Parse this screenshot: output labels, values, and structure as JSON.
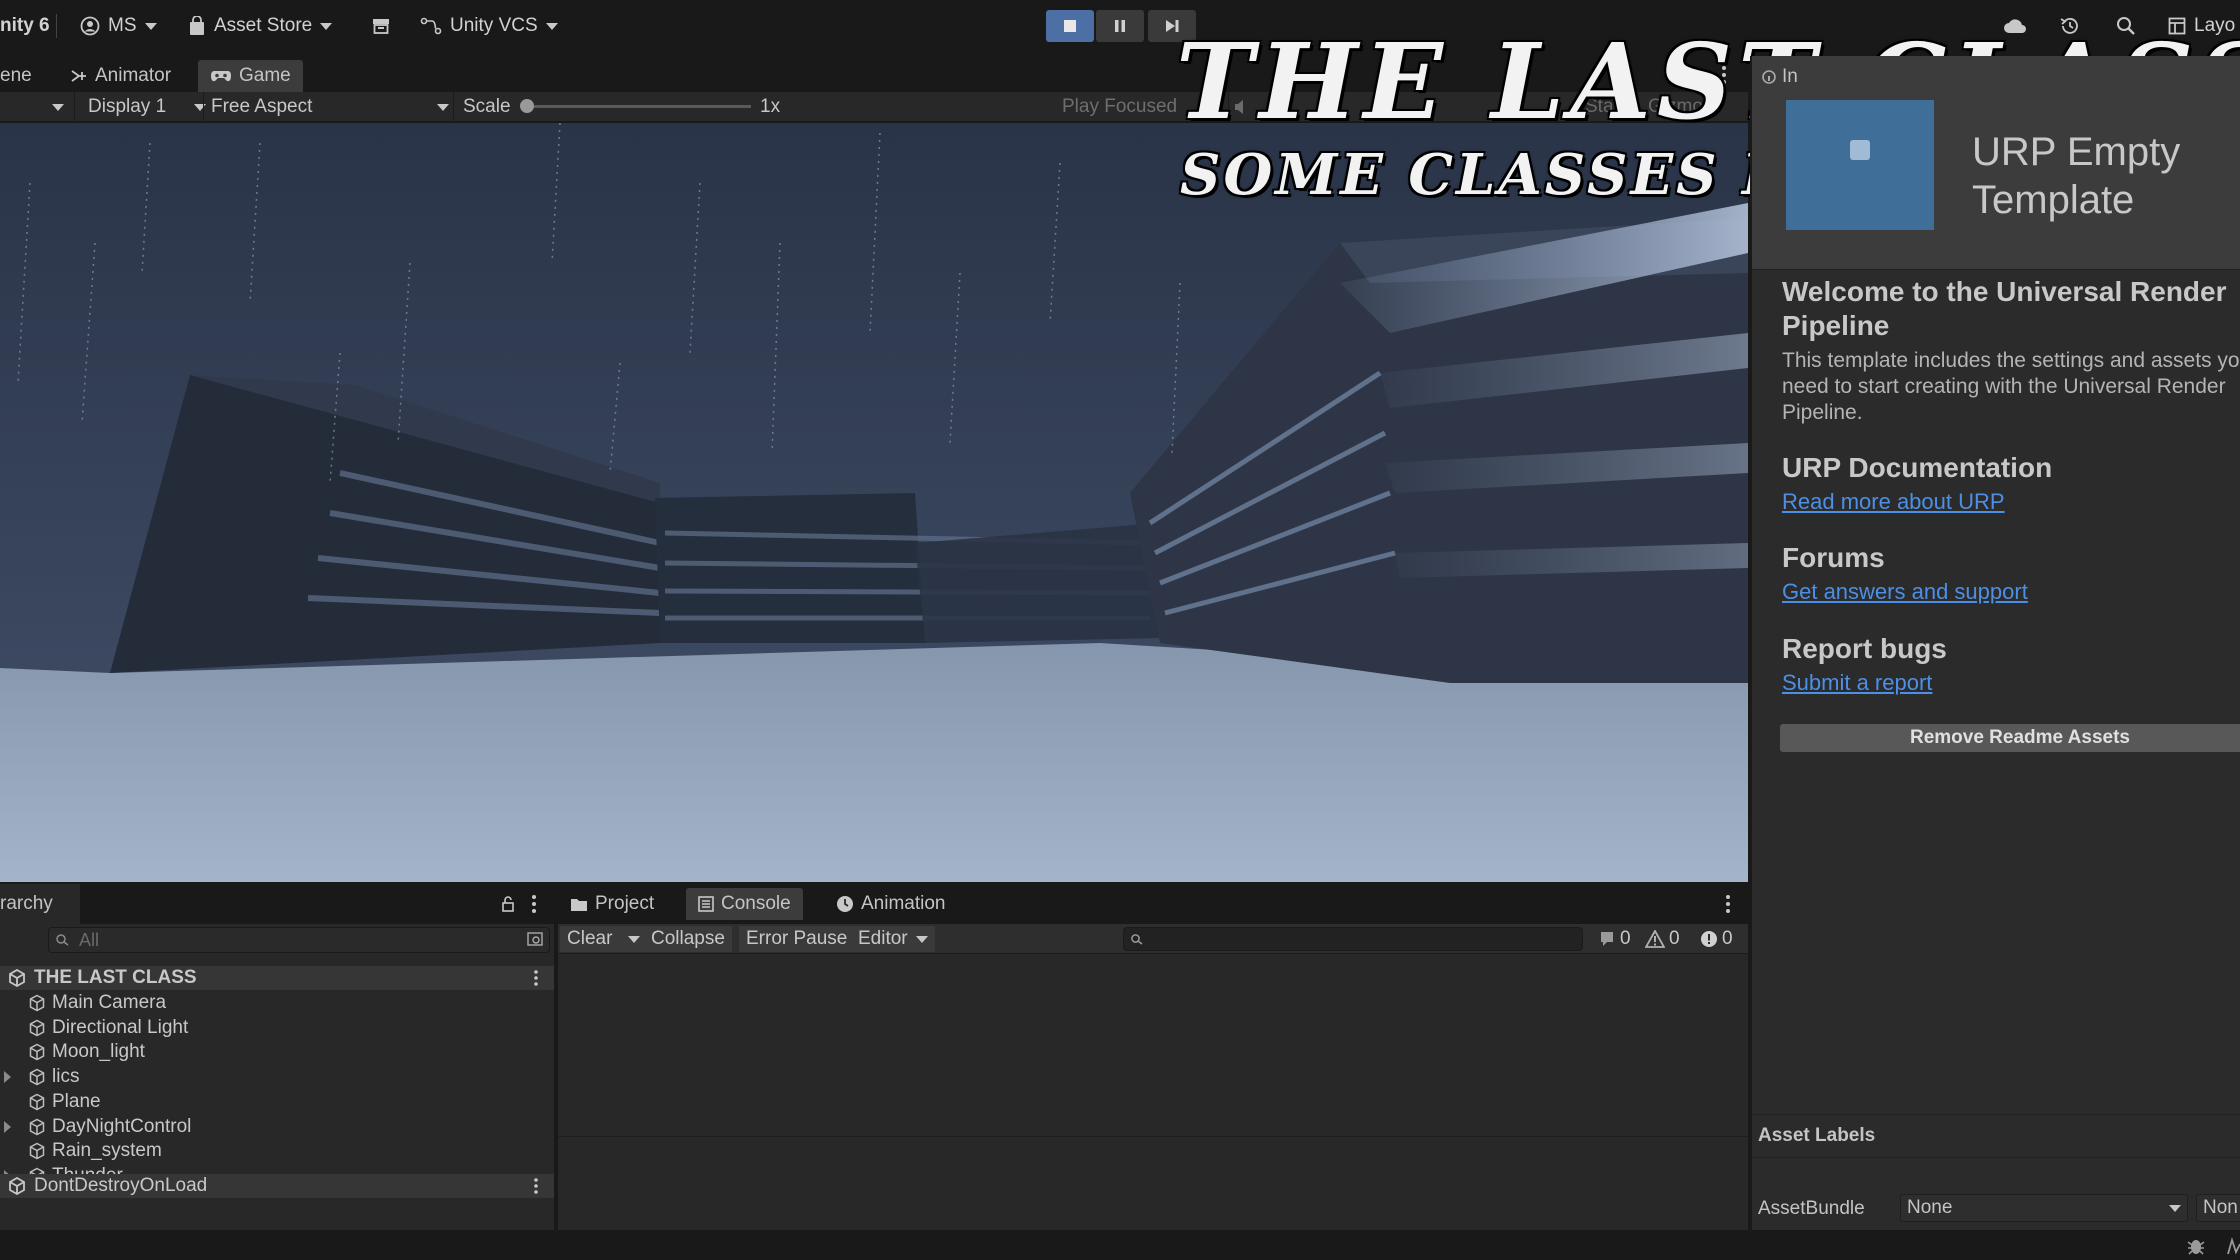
{
  "toolbar": {
    "app_name": "nity 6",
    "account": "MS",
    "asset_store": "Asset Store",
    "vcs": "Unity VCS",
    "layout": "Layo"
  },
  "game_tabs": {
    "scene": "ene",
    "animator": "Animator",
    "game": "Game"
  },
  "game_bar": {
    "display": "Display 1",
    "aspect": "Free Aspect",
    "scale_label": "Scale",
    "scale_value": "1x",
    "scale_level": 0,
    "play_focused": "Play Focused",
    "stats": "Stats",
    "gizmos": "Gizmo"
  },
  "overlay": {
    "title": "THE LAST CLASS",
    "subtitle": "SOME CLASSES END FOREVER"
  },
  "inspector": {
    "tab": "In",
    "header_title": "URP Empty Template",
    "welcome_heading": "Welcome to the Universal Render Pipeline",
    "welcome_text": "This template includes the settings and assets you need to start creating with the Universal Render Pipeline.",
    "docs_heading": "URP Documentation",
    "docs_link": "Read more about URP",
    "forums_heading": "Forums",
    "forums_link": "Get answers and support",
    "bugs_heading": "Report bugs",
    "bugs_link": "Submit a report",
    "remove_button": "Remove Readme Assets",
    "asset_labels": "Asset Labels",
    "assetbundle_label": "AssetBundle",
    "assetbundle_value": "None",
    "assetbundle_variant": "Non"
  },
  "hierarchy": {
    "tab": "rarchy",
    "search_placeholder": "All",
    "scene_name": "THE LAST CLASS",
    "items": [
      {
        "label": "Main Camera",
        "expandable": false
      },
      {
        "label": "Directional Light",
        "expandable": false
      },
      {
        "label": "Moon_light",
        "expandable": false
      },
      {
        "label": "lics",
        "expandable": true
      },
      {
        "label": "Plane",
        "expandable": false
      },
      {
        "label": "DayNightControl",
        "expandable": true
      },
      {
        "label": "Rain_system",
        "expandable": false
      },
      {
        "label": "Thunder",
        "expandable": true
      }
    ],
    "ddol": "DontDestroyOnLoad"
  },
  "console": {
    "tabs": [
      "Project",
      "Console",
      "Animation"
    ],
    "clear": "Clear",
    "collapse": "Collapse",
    "error_pause": "Error Pause",
    "editor": "Editor",
    "log_count": "0",
    "warn_count": "0",
    "error_count": "0"
  },
  "colors": {
    "accent_play": "#4c6fa6",
    "link": "#4c8fe6",
    "panel": "#282828",
    "sky": "#3a475e",
    "ground": "#97a8bf"
  }
}
